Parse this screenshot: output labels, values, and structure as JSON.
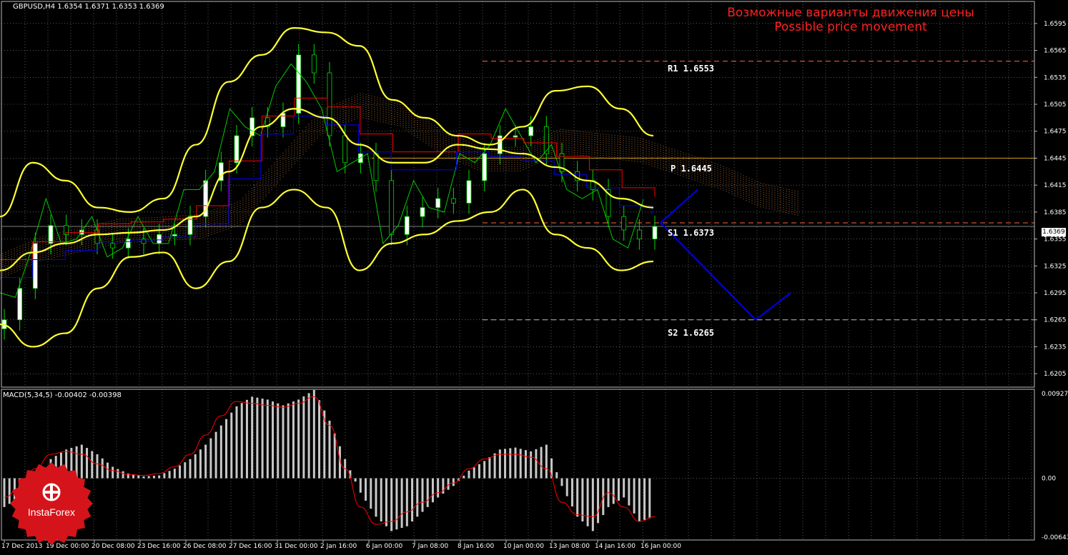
{
  "window": {
    "symbol_header": "GBPUSD,H4  1.6354 1.6371 1.6353 1.6369",
    "indicator_header": "MACD(5,34,5) -0.00402 -0.00398",
    "title_ru": "Возможные варианты движения цены",
    "title_en": "Possible price movement",
    "current_price": "1.6369",
    "logo_text": "InstaForex"
  },
  "colors": {
    "background": "#000000",
    "grid": "#8a8a8a",
    "bull_candle": "#ffffff",
    "bear_candle": "#000000",
    "wick": "#00dd00",
    "bollinger": "#ffff33",
    "tenkan": "#ff0000",
    "kijun": "#0000ff",
    "chikou": "#00cc00",
    "kumo": "#e8944a",
    "pivot": "#d4a017",
    "resistance": "#ff6633",
    "forecast": "#0000dd",
    "macd_hist": "#c8c8c8",
    "macd_signal": "#ff0000",
    "title": "#ff2020"
  },
  "levels": [
    {
      "name": "R1",
      "label": "R1 1.6553",
      "value": 1.6553
    },
    {
      "name": "P",
      "label": "P 1.6445",
      "value": 1.6445
    },
    {
      "name": "S1",
      "label": "S1 1.6373",
      "value": 1.6373
    },
    {
      "name": "S2",
      "label": "S2 1.6265",
      "value": 1.6265
    }
  ],
  "chart_data": [
    {
      "type": "line",
      "title": "GBPUSD,H4",
      "ylim": [
        1.619,
        1.661
      ],
      "y_ticks": [
        "1.6595",
        "1.6565",
        "1.6535",
        "1.6505",
        "1.6475",
        "1.6445",
        "1.6415",
        "1.6385",
        "1.6355",
        "1.6325",
        "1.6295",
        "1.6265",
        "1.6235",
        "1.6205"
      ],
      "x_ticks": [
        "17 Dec 2013",
        "19 Dec 00:00",
        "20 Dec 08:00",
        "23 Dec 16:00",
        "26 Dec 08:00",
        "27 Dec 16:00",
        "31 Dec 00:00",
        "2 Jan 16:00",
        "6 Jan 00:00",
        "7 Jan 08:00",
        "8 Jan 16:00",
        "10 Jan 00:00",
        "13 Jan 08:00",
        "14 Jan 16:00",
        "16 Jan 00:00"
      ],
      "grid": true,
      "series": [
        {
          "name": "Close",
          "values": [
            1.6265,
            1.63,
            1.635,
            1.637,
            1.636,
            1.6365,
            1.635,
            1.6345,
            1.6355,
            1.635,
            1.636,
            1.636,
            1.638,
            1.642,
            1.644,
            1.647,
            1.649,
            1.648,
            1.6495,
            1.656,
            1.654,
            1.647,
            1.644,
            1.645,
            1.642,
            1.636,
            1.638,
            1.639,
            1.64,
            1.6395,
            1.642,
            1.645,
            1.647,
            1.647,
            1.648,
            1.645,
            1.643,
            1.642,
            1.641,
            1.638,
            1.6365,
            1.6355,
            1.6369
          ]
        },
        {
          "name": "BB upper",
          "values": [
            1.638,
            1.644,
            1.642,
            1.639,
            1.6385,
            1.64,
            1.646,
            1.653,
            1.656,
            1.659,
            1.6585,
            1.657,
            1.651,
            1.649,
            1.647,
            1.646,
            1.648,
            1.652,
            1.6525,
            1.65,
            1.647
          ]
        },
        {
          "name": "BB middle",
          "values": [
            1.632,
            1.634,
            1.635,
            1.636,
            1.6362,
            1.6365,
            1.638,
            1.643,
            1.648,
            1.65,
            1.649,
            1.646,
            1.644,
            1.644,
            1.646,
            1.6455,
            1.645,
            1.6435,
            1.642,
            1.64,
            1.639
          ]
        },
        {
          "name": "BB lower",
          "values": [
            1.626,
            1.6235,
            1.625,
            1.63,
            1.6335,
            1.634,
            1.63,
            1.633,
            1.639,
            1.641,
            1.639,
            1.632,
            1.635,
            1.636,
            1.6375,
            1.6385,
            1.641,
            1.636,
            1.6345,
            1.632,
            1.633
          ]
        },
        {
          "name": "Forecast",
          "values": [
            1.6373,
            1.641,
            1.6373,
            1.6265,
            1.6295
          ]
        }
      ]
    },
    {
      "type": "bar",
      "title": "MACD(5,34,5)",
      "ylim": [
        -0.00643,
        0.00927
      ],
      "y_ticks": [
        "0.00927",
        "0.00",
        "-0.00643"
      ],
      "series": [
        {
          "name": "MACD",
          "values": [
            -0.003,
            -0.002,
            -0.0008,
            0.002,
            0.003,
            0.0035,
            0.0025,
            0.0012,
            0.0005,
            0.0002,
            0.0003,
            0.001,
            0.002,
            0.0035,
            0.0055,
            0.0075,
            0.0085,
            0.0082,
            0.0076,
            0.0082,
            0.0092,
            0.006,
            0.002,
            -0.0015,
            -0.004,
            -0.0055,
            -0.005,
            -0.0035,
            -0.002,
            -0.0008,
            0.0008,
            0.0018,
            0.003,
            0.0032,
            0.0028,
            0.0035,
            -0.0008,
            -0.004,
            -0.0055,
            -0.003,
            -0.002,
            -0.0045,
            -0.004
          ]
        },
        {
          "name": "Signal",
          "values": [
            -0.002,
            -0.001,
            0.001,
            0.0025,
            0.0028,
            0.0025,
            0.0015,
            0.0008,
            0.0004,
            0.0003,
            0.0005,
            0.0012,
            0.0025,
            0.0045,
            0.0065,
            0.008,
            0.0078,
            0.0076,
            0.0074,
            0.0078,
            0.0085,
            0.0055,
            0.001,
            -0.003,
            -0.0048,
            -0.0045,
            -0.0035,
            -0.0025,
            -0.0015,
            -0.0005,
            0.001,
            0.002,
            0.0025,
            0.0025,
            0.0022,
            0.001,
            -0.0025,
            -0.0038,
            -0.004,
            -0.0015,
            -0.003,
            -0.0045,
            -0.004
          ]
        }
      ]
    }
  ]
}
